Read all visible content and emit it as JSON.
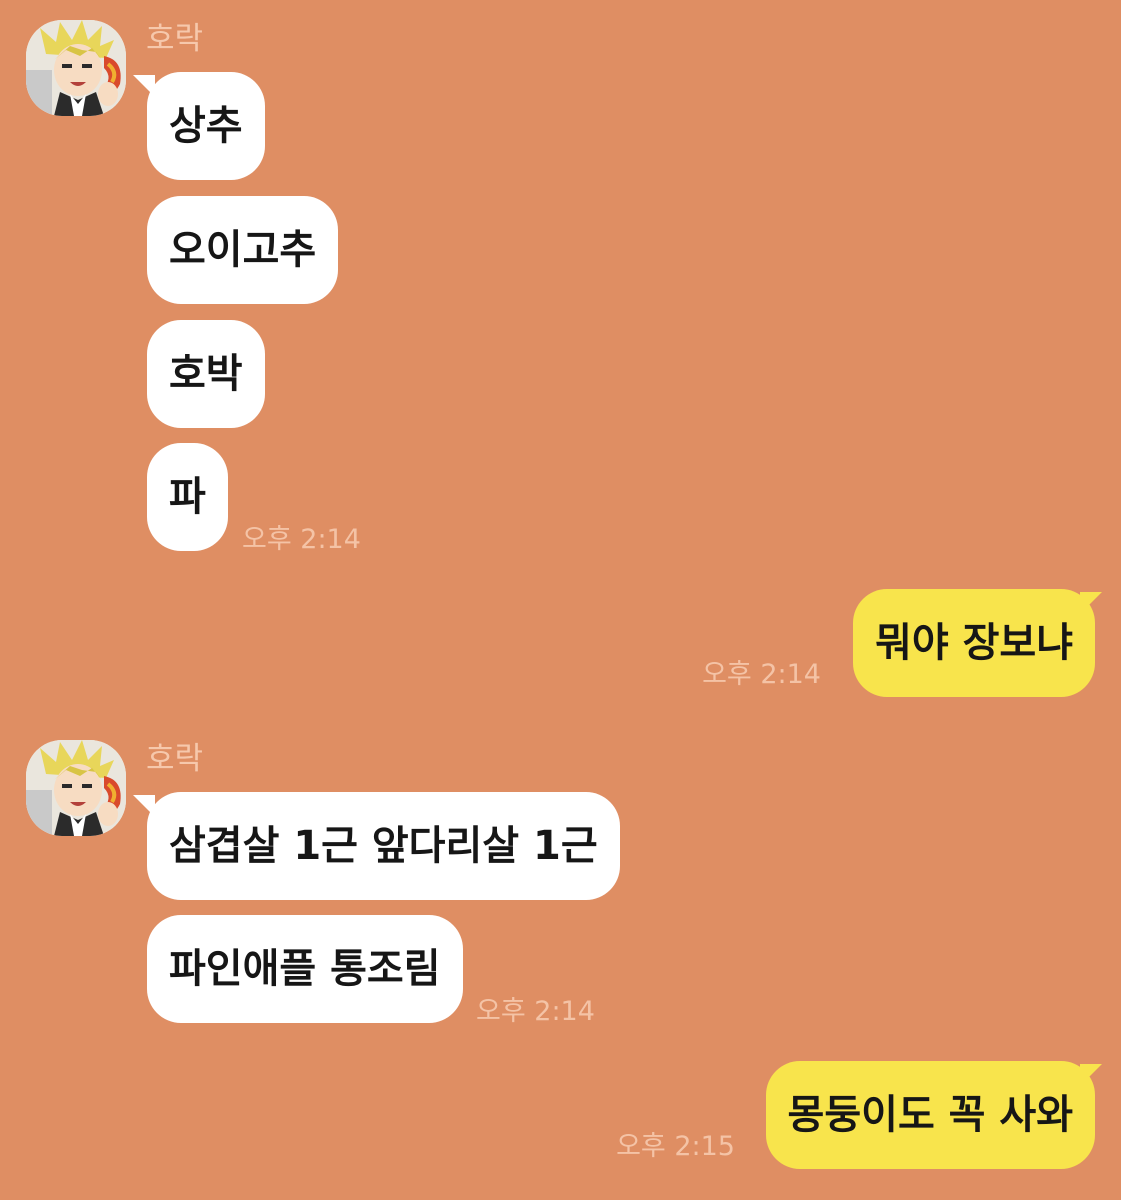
{
  "chat": {
    "sender_name": "호락",
    "groups": [
      {
        "messages": [
          "상추",
          "오이고추",
          "호박",
          "파"
        ],
        "time": "오후 2:14"
      },
      {
        "messages": [
          "삼겹살 1근 앞다리살 1근",
          "파인애플 통조림"
        ],
        "time": "오후 2:14"
      }
    ],
    "outgoing": [
      {
        "message": "뭐야 장보냐",
        "time": "오후 2:14"
      },
      {
        "message": "몽둥이도 꼭 사와",
        "time": "오후 2:15"
      }
    ]
  },
  "colors": {
    "background": "#df8e63",
    "incoming_bubble": "#ffffff",
    "outgoing_bubble": "#f8e44c",
    "sender_name": "#f6c8ac",
    "timestamp": "#f4c3a6"
  },
  "icons": {
    "avatar": "anime-character-avatar-icon"
  }
}
